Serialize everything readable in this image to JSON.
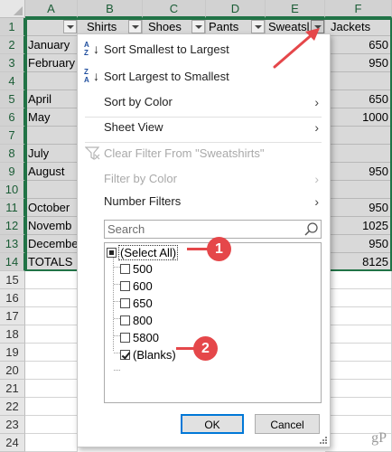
{
  "columns": [
    "A",
    "B",
    "C",
    "D",
    "E",
    "F"
  ],
  "rows": [
    "1",
    "2",
    "3",
    "4",
    "5",
    "6",
    "7",
    "8",
    "9",
    "10",
    "11",
    "12",
    "13",
    "14",
    "15",
    "16",
    "17",
    "18",
    "19",
    "20",
    "21",
    "22",
    "23",
    "24"
  ],
  "headers": {
    "shirts": "Shirts",
    "shoes": "Shoes",
    "pants": "Pants",
    "sweatshirts": "Sweatsl",
    "jackets": "Jackets"
  },
  "months": [
    "January",
    "February",
    "",
    "April",
    "May",
    "",
    "July",
    "August",
    "",
    "October",
    "Novemb",
    "Decembe",
    "TOTALS"
  ],
  "jackets": [
    "650",
    "950",
    "",
    "650",
    "1000",
    "",
    "",
    "950",
    "",
    "950",
    "1025",
    "950",
    "8125"
  ],
  "menu": {
    "sort_asc": "Sort Smallest to Largest",
    "sort_desc": "Sort Largest to Smallest",
    "sort_by_color": "Sort by Color",
    "sheet_view": "Sheet View",
    "clear_filter": "Clear Filter From \"Sweatshirts\"",
    "filter_by_color": "Filter by Color",
    "number_filters": "Number Filters",
    "search_placeholder": "Search",
    "items": [
      {
        "label": "(Select All)",
        "state": "partial"
      },
      {
        "label": "500",
        "state": "unchecked"
      },
      {
        "label": "600",
        "state": "unchecked"
      },
      {
        "label": "650",
        "state": "unchecked"
      },
      {
        "label": "800",
        "state": "unchecked"
      },
      {
        "label": "5800",
        "state": "unchecked"
      },
      {
        "label": "(Blanks)",
        "state": "checked"
      }
    ],
    "ok": "OK",
    "cancel": "Cancel"
  },
  "callouts": [
    "1",
    "2"
  ],
  "watermark": "gP",
  "colors": {
    "accent_green": "#217346",
    "callout_red": "#e5474a",
    "filtered_shade": "#d9d9d9",
    "ok_border": "#0078d7"
  },
  "icons": [
    "sort-ascending-icon",
    "sort-descending-icon",
    "chevron-right-icon",
    "clear-filter-icon",
    "search-icon",
    "filter-dropdown-icon",
    "resize-grip-icon"
  ]
}
